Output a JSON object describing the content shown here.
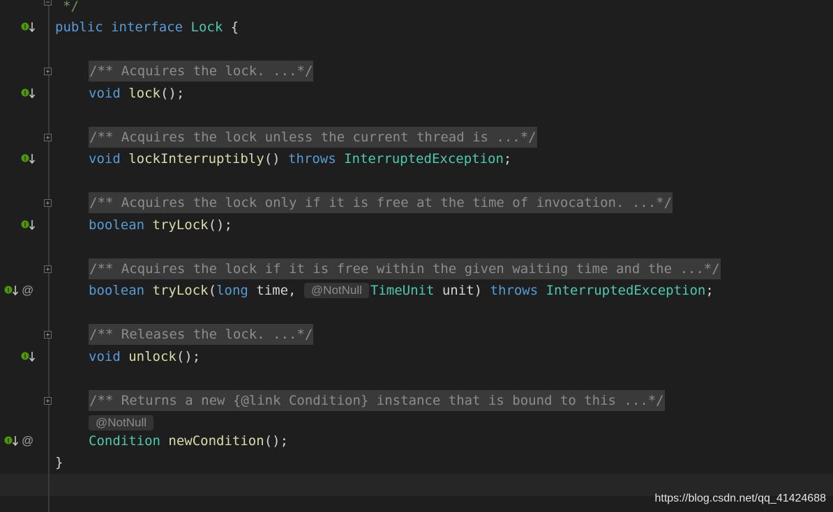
{
  "editor": {
    "comment_close": "*/",
    "header": {
      "kw_public": "public",
      "kw_interface": "interface",
      "name": "Lock",
      "open_brace": "{"
    },
    "methods": [
      {
        "doc": "/** Acquires the lock. ...*/",
        "ret": "void",
        "name": "lock",
        "tail": "();"
      },
      {
        "doc": "/** Acquires the lock unless the current thread is ...*/",
        "ret": "void",
        "name": "lockInterruptibly",
        "mid": "() ",
        "throws": "throws",
        "exc": "InterruptedException",
        "tail": ";"
      },
      {
        "doc": "/** Acquires the lock only if it is free at the time of invocation. ...*/",
        "ret": "boolean",
        "name": "tryLock",
        "tail": "();"
      },
      {
        "doc": "/** Acquires the lock if it is free within the given waiting time and the ...*/",
        "ret": "boolean",
        "name": "tryLock",
        "open": "(",
        "p1_type": "long",
        "p1_name": " time, ",
        "anno": "@NotNull",
        "p2_type": "TimeUnit",
        "p2_name": " unit) ",
        "throws": "throws",
        "exc": "InterruptedException",
        "tail": ";"
      },
      {
        "doc": "/** Releases the lock. ...*/",
        "ret": "void",
        "name": "unlock",
        "tail": "();"
      },
      {
        "doc": "/** Returns a new {@link Condition} instance that is bound to this ...*/",
        "anno": "@NotNull",
        "ret": "Condition",
        "name": "newCondition",
        "tail": "();"
      }
    ],
    "close_brace": "}",
    "at_symbol": "@"
  },
  "watermark": "https://blog.csdn.net/qq_41424688",
  "colors": {
    "background": "#1e1e1e",
    "keyword": "#569cd6",
    "type": "#4ec9b0",
    "method": "#dcdcaa",
    "doc_fold_bg": "#3a3a3a",
    "impl_icon_green": "#4e9a06"
  }
}
